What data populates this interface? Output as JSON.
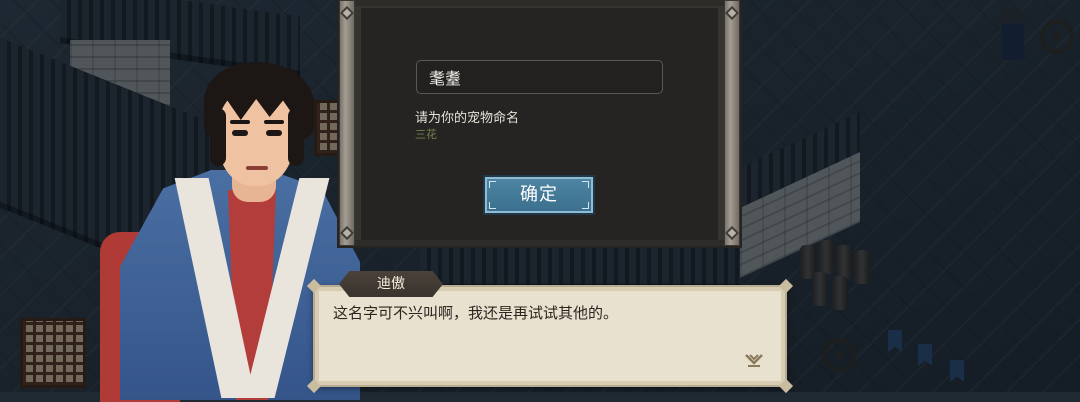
{
  "naming_dialog": {
    "input_value": "耄耋",
    "prompt": "请为你的宠物命名",
    "suggestion": "三花",
    "confirm_label": "确定"
  },
  "speech": {
    "speaker": "迪傲",
    "text": "这名字可不兴叫啊，我还是再试试其他的。"
  },
  "colors": {
    "confirm_button": "#3f7694",
    "dialog_bg": "#363431",
    "speech_bg": "#e9e1cf",
    "speaker_tag": "#3f3731"
  }
}
